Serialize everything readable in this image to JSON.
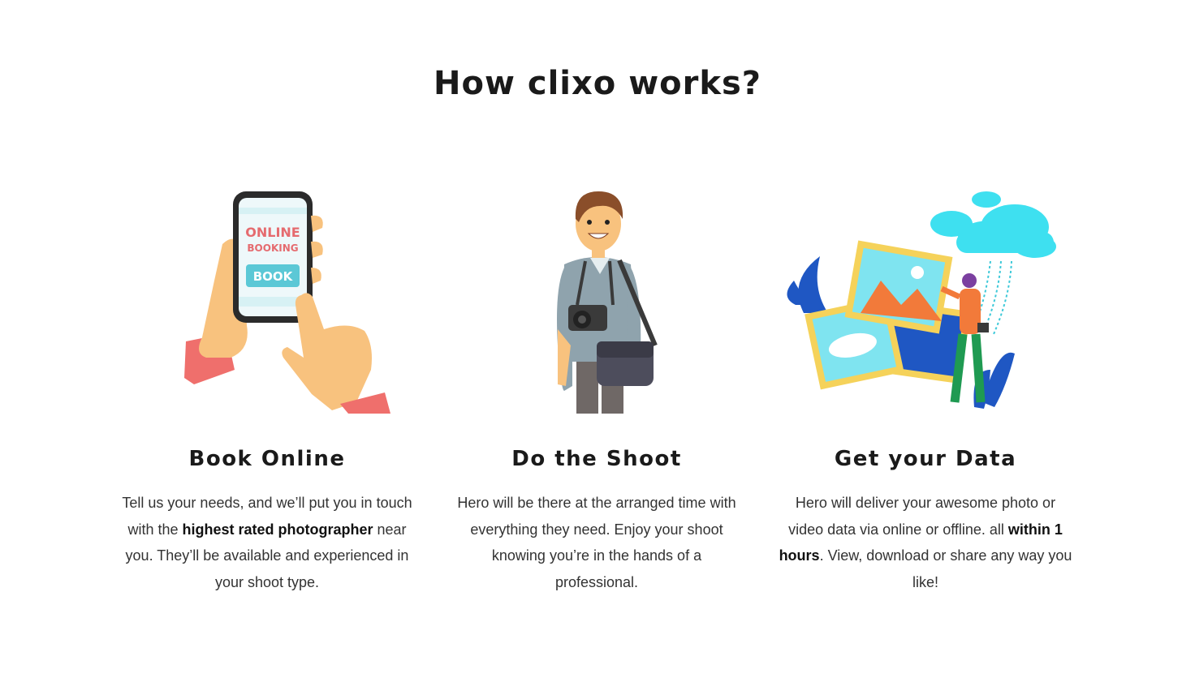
{
  "section": {
    "title": "How clixo works?"
  },
  "steps": [
    {
      "title": "Book Online",
      "illustration": "phone-booking-illustration",
      "phone_text_line1": "ONLINE",
      "phone_text_line2": "BOOKING",
      "phone_button": "BOOK",
      "desc": [
        "Tell us your needs, and we’ll put you in touch with the ",
        "highest rated photographer",
        " near you. They’ll be available and experienced in your shoot type."
      ]
    },
    {
      "title": "Do the Shoot",
      "illustration": "photographer-illustration",
      "desc": [
        "Hero will be there at the arranged time with everything they need. Enjoy your shoot knowing you’re in the hands of a professional."
      ]
    },
    {
      "title": "Get your Data",
      "illustration": "cloud-photos-illustration",
      "desc": [
        "Hero will deliver your awesome photo or video data via online or offline. all ",
        "within 1 hours",
        ". View, download or share any way you like!"
      ]
    }
  ],
  "colors": {
    "accent_teal": "#5bc8d6",
    "booking_red": "#e56b6f",
    "cloud_cyan": "#3ee0f0",
    "leaf_blue": "#1f57c3",
    "skin": "#f8c27e"
  }
}
